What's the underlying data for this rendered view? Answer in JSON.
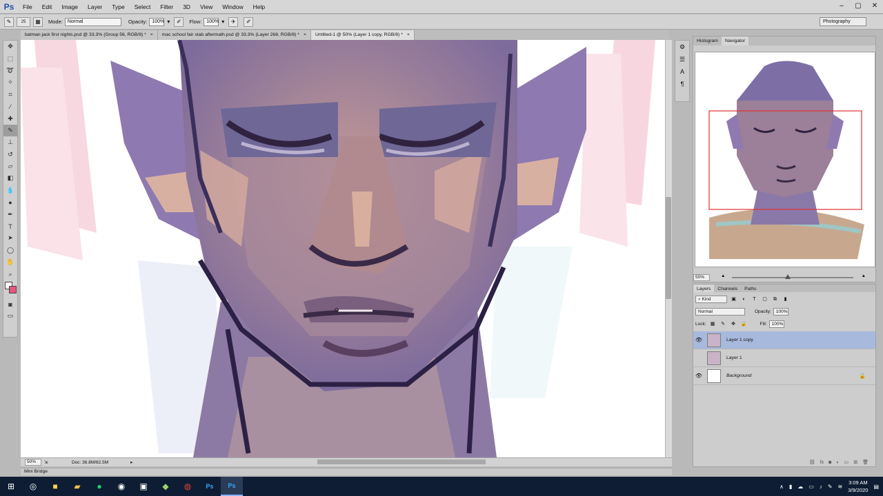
{
  "app": {
    "logo": "Ps",
    "menus": [
      "File",
      "Edit",
      "Image",
      "Layer",
      "Type",
      "Select",
      "Filter",
      "3D",
      "View",
      "Window",
      "Help"
    ],
    "window_controls": [
      "–",
      "▢",
      "✕"
    ]
  },
  "options_bar": {
    "brush_size": "25",
    "mode_label": "Mode:",
    "mode_value": "Normal",
    "opacity_label": "Opacity:",
    "opacity_value": "100%",
    "flow_label": "Flow:",
    "flow_value": "100%",
    "workspace": "Photography"
  },
  "tabs": [
    {
      "label": "batman jack first nights.psd @ 33.3% (Group 56, RGB/8) *",
      "active": false
    },
    {
      "label": "mac school fair stab aftermath.psd @ 33.3% (Layer 268, RGB/8) *",
      "active": false
    },
    {
      "label": "Untitled-1 @ 50% (Layer 1 copy, RGB/8) *",
      "active": true
    }
  ],
  "status": {
    "zoom": "50%",
    "doc": "Doc: 36.8M/82.5M",
    "mini_bridge": "Mini Bridge"
  },
  "navigator": {
    "tabs": [
      "Histogram",
      "Navigator"
    ],
    "active_tab": "Navigator",
    "zoom": "50%"
  },
  "layers": {
    "tabs": [
      "Layers",
      "Channels",
      "Paths"
    ],
    "kind": "Kind",
    "blend_mode": "Normal",
    "opacity_label": "Opacity:",
    "opacity_value": "100%",
    "lock_label": "Lock:",
    "fill_label": "Fill:",
    "fill_value": "100%",
    "items": [
      {
        "name": "Layer 1 copy",
        "visible": true,
        "selected": true
      },
      {
        "name": "Layer 1",
        "visible": false,
        "selected": false
      },
      {
        "name": "Background",
        "visible": true,
        "selected": false,
        "locked": true
      }
    ]
  },
  "taskbar": {
    "time": "3:09 AM",
    "date": "3/9/2020"
  },
  "colors": {
    "foreground": "#ffffff",
    "background": "#e8557f",
    "selection": "#a7b9dd",
    "taskbar": "#0e1d33"
  }
}
